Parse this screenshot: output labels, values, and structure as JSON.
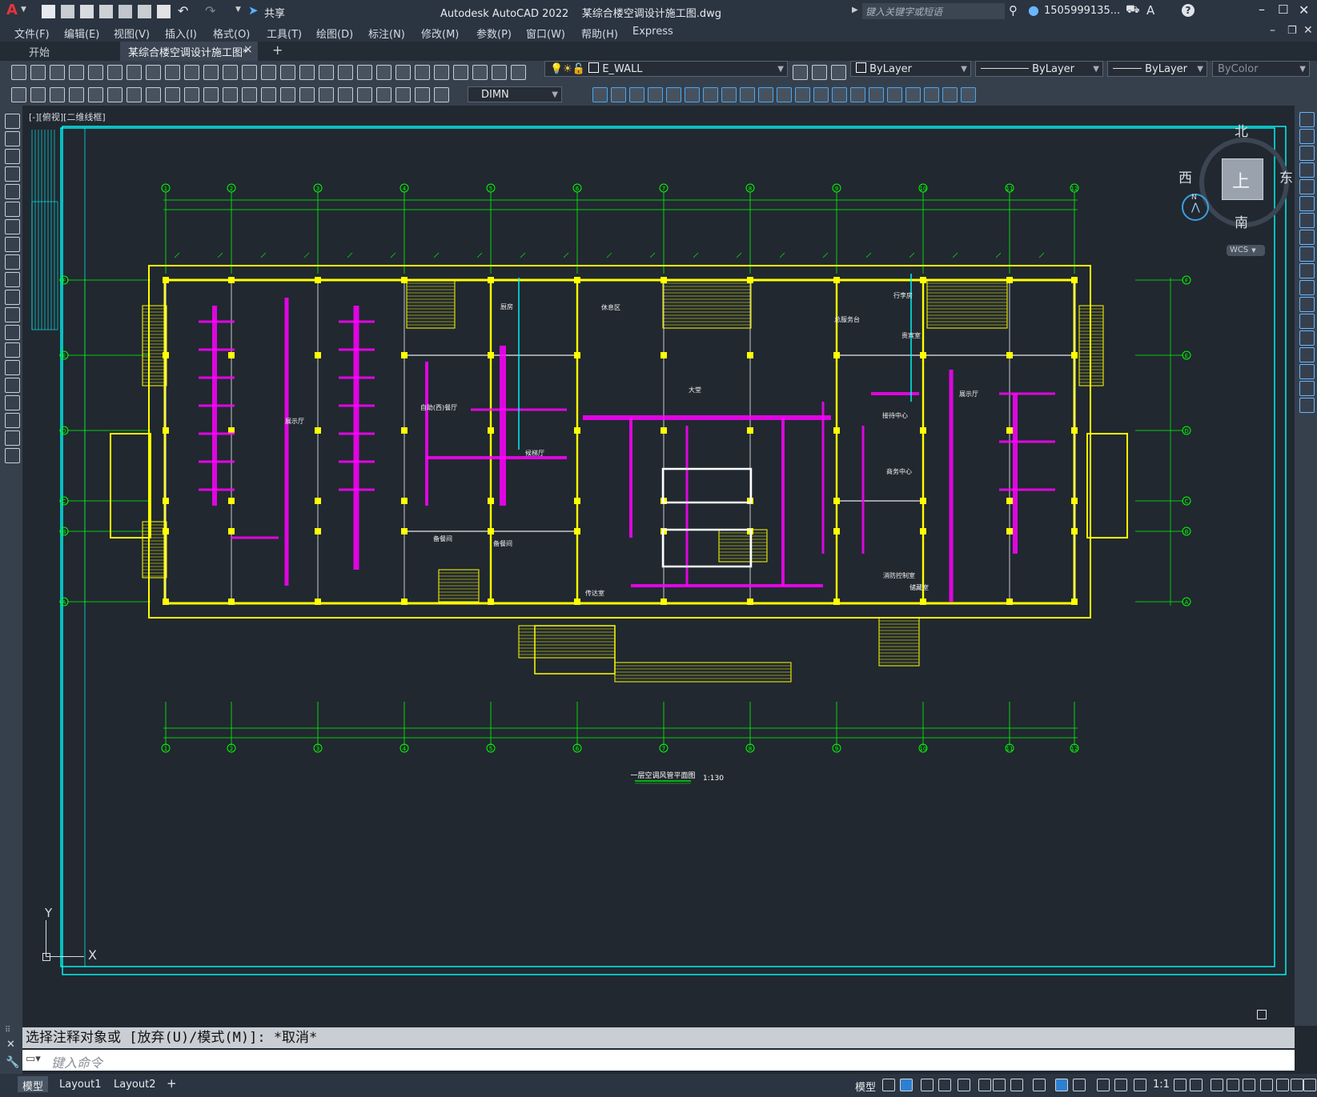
{
  "app": {
    "logo": "A",
    "title": "Autodesk AutoCAD 2022",
    "document": "某综合楼空调设计施工图.dwg",
    "share_label": "共享",
    "search_placeholder": "键入关键字或短语",
    "user": "1505999135...",
    "help_icon": "?"
  },
  "menu": [
    "文件(F)",
    "编辑(E)",
    "视图(V)",
    "插入(I)",
    "格式(O)",
    "工具(T)",
    "绘图(D)",
    "标注(N)",
    "修改(M)",
    "参数(P)",
    "窗口(W)",
    "帮助(H)",
    "Express"
  ],
  "tabs": {
    "start": "开始",
    "active": "某综合楼空调设计施工图*",
    "close": "×",
    "add": "+"
  },
  "properties": {
    "layer": "E_WALL",
    "color": "ByLayer",
    "linetype": "ByLayer",
    "lineweight": "ByLayer",
    "plotstyle": "ByColor",
    "dimstyle": "DIMN"
  },
  "viewport": {
    "label": "[-][俯视][二维线框]",
    "viewcube": {
      "north": "北",
      "south": "南",
      "east": "东",
      "west": "西",
      "face": "上",
      "wcs": "WCS",
      "compass_n": "N"
    },
    "ucs": {
      "x": "X",
      "y": "Y"
    }
  },
  "drawing": {
    "title": "一层空调风管平面图",
    "scale": "1:130",
    "column_axes": [
      "1",
      "2",
      "3",
      "4",
      "5",
      "6",
      "7",
      "8",
      "9",
      "10",
      "11",
      "12"
    ],
    "row_axes": [
      "A",
      "B",
      "C",
      "D",
      "E",
      "F"
    ],
    "rooms": [
      "展示厅",
      "自助(西)餐厅",
      "厨房",
      "备餐间",
      "候梯厅",
      "休息区",
      "大堂",
      "接待中心",
      "商务中心",
      "总服务台",
      "行李房",
      "贵宾室",
      "消防控制室",
      "储藏室",
      "展示厅",
      "备餐间",
      "传达室"
    ]
  },
  "command": {
    "history": "选择注释对象或 [放弃(U)/模式(M)]: *取消*",
    "placeholder": "键入命令"
  },
  "layouts": [
    "模型",
    "Layout1",
    "Layout2"
  ],
  "status": {
    "model": "模型",
    "scale": "1:1"
  },
  "colors": {
    "wall": "#ffff00",
    "duct": "#ff00ff",
    "axis": "#00ff00",
    "border": "#00ffff",
    "background": "#212830"
  }
}
